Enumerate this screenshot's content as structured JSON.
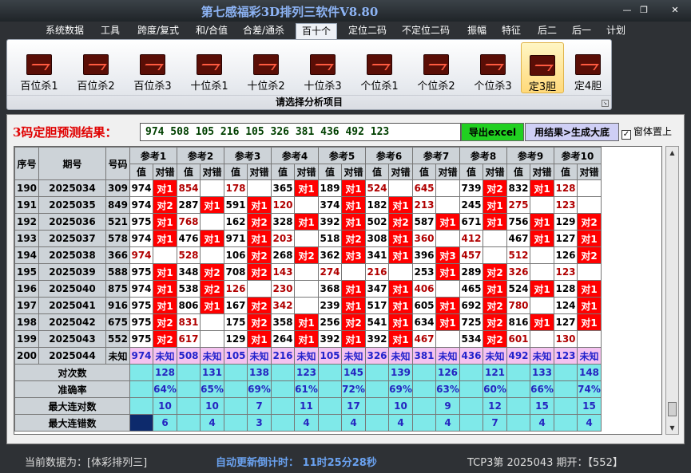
{
  "window": {
    "title": "第七感福彩3D排列三软件V8.80",
    "min": "—",
    "restore": "❐",
    "close": "✕"
  },
  "menu": [
    "系统数据",
    "工具",
    "跨度/复式",
    "和/合值",
    "合差/通杀",
    "百十个",
    "定位二码",
    "不定位二码",
    "振幅",
    "特征",
    "后二",
    "后一",
    "计划"
  ],
  "menu_selected": 5,
  "ribbon": {
    "buttons": [
      "百位杀1",
      "百位杀2",
      "百位杀3",
      "十位杀1",
      "十位杀2",
      "十位杀3",
      "个位杀1",
      "个位杀2",
      "个位杀3",
      "定3胆",
      "定4胆"
    ],
    "selected": 9,
    "caption": "请选择分析项目",
    "icon": "chart-icon"
  },
  "prediction": {
    "label": "3码定胆预测结果：",
    "value": "974 508 105 216 105 326 381 436 492 123",
    "export_btn": "导出excel",
    "gen_btn": "用结果>生成大底",
    "ontop_label": "窗体置上",
    "ontop_checked": "✓"
  },
  "table": {
    "col_seq": "序号",
    "col_period": "期号",
    "col_code": "号码",
    "refs": [
      "参考1",
      "参考2",
      "参考3",
      "参考4",
      "参考5",
      "参考6",
      "参考7",
      "参考8",
      "参考9",
      "参考10"
    ],
    "sub_val": "值",
    "sub_res": "对错",
    "hit": "对1",
    "miss": "对2",
    "rows": [
      {
        "seq": "190",
        "period": "2025034",
        "code": "309",
        "cells": [
          [
            "974",
            "对1"
          ],
          [
            "854",
            ""
          ],
          [
            "178",
            ""
          ],
          [
            "365",
            "对1"
          ],
          [
            "189",
            "对1"
          ],
          [
            "524",
            ""
          ],
          [
            "645",
            ""
          ],
          [
            "739",
            "对2"
          ],
          [
            "832",
            "对1"
          ],
          [
            "128",
            ""
          ]
        ]
      },
      {
        "seq": "191",
        "period": "2025035",
        "code": "849",
        "cells": [
          [
            "974",
            "对2"
          ],
          [
            "287",
            "对1"
          ],
          [
            "591",
            "对1"
          ],
          [
            "120",
            ""
          ],
          [
            "374",
            "对1"
          ],
          [
            "182",
            "对1"
          ],
          [
            "213",
            ""
          ],
          [
            "245",
            "对1"
          ],
          [
            "275",
            ""
          ],
          [
            "123",
            ""
          ]
        ]
      },
      {
        "seq": "192",
        "period": "2025036",
        "code": "521",
        "cells": [
          [
            "975",
            "对1"
          ],
          [
            "768",
            ""
          ],
          [
            "162",
            "对2"
          ],
          [
            "328",
            "对1"
          ],
          [
            "392",
            "对1"
          ],
          [
            "502",
            "对2"
          ],
          [
            "587",
            "对1"
          ],
          [
            "671",
            "对1"
          ],
          [
            "756",
            "对1"
          ],
          [
            "129",
            "对2"
          ]
        ]
      },
      {
        "seq": "193",
        "period": "2025037",
        "code": "578",
        "cells": [
          [
            "974",
            "对1"
          ],
          [
            "476",
            "对1"
          ],
          [
            "971",
            "对1"
          ],
          [
            "203",
            ""
          ],
          [
            "518",
            "对2"
          ],
          [
            "308",
            "对1"
          ],
          [
            "360",
            ""
          ],
          [
            "412",
            ""
          ],
          [
            "467",
            "对1"
          ],
          [
            "127",
            "对1"
          ]
        ]
      },
      {
        "seq": "194",
        "period": "2025038",
        "code": "366",
        "cells": [
          [
            "974",
            ""
          ],
          [
            "528",
            ""
          ],
          [
            "106",
            "对2"
          ],
          [
            "268",
            "对2"
          ],
          [
            "362",
            "对3"
          ],
          [
            "341",
            "对1"
          ],
          [
            "396",
            "对3"
          ],
          [
            "457",
            ""
          ],
          [
            "512",
            ""
          ],
          [
            "126",
            "对2"
          ]
        ]
      },
      {
        "seq": "195",
        "period": "2025039",
        "code": "588",
        "cells": [
          [
            "975",
            "对1"
          ],
          [
            "348",
            "对2"
          ],
          [
            "708",
            "对2"
          ],
          [
            "143",
            ""
          ],
          [
            "274",
            ""
          ],
          [
            "216",
            ""
          ],
          [
            "253",
            "对1"
          ],
          [
            "289",
            "对2"
          ],
          [
            "326",
            ""
          ],
          [
            "123",
            ""
          ]
        ]
      },
      {
        "seq": "196",
        "period": "2025040",
        "code": "875",
        "cells": [
          [
            "974",
            "对1"
          ],
          [
            "538",
            "对2"
          ],
          [
            "126",
            ""
          ],
          [
            "230",
            ""
          ],
          [
            "368",
            "对1"
          ],
          [
            "347",
            "对1"
          ],
          [
            "406",
            ""
          ],
          [
            "465",
            "对1"
          ],
          [
            "524",
            "对1"
          ],
          [
            "128",
            "对1"
          ]
        ]
      },
      {
        "seq": "197",
        "period": "2025041",
        "code": "916",
        "cells": [
          [
            "975",
            "对1"
          ],
          [
            "806",
            "对1"
          ],
          [
            "167",
            "对2"
          ],
          [
            "342",
            ""
          ],
          [
            "239",
            "对1"
          ],
          [
            "517",
            "对1"
          ],
          [
            "605",
            "对1"
          ],
          [
            "692",
            "对2"
          ],
          [
            "780",
            ""
          ],
          [
            "124",
            "对1"
          ]
        ]
      },
      {
        "seq": "198",
        "period": "2025042",
        "code": "675",
        "cells": [
          [
            "975",
            "对2"
          ],
          [
            "831",
            ""
          ],
          [
            "175",
            "对2"
          ],
          [
            "358",
            "对1"
          ],
          [
            "256",
            "对2"
          ],
          [
            "541",
            "对1"
          ],
          [
            "634",
            "对1"
          ],
          [
            "725",
            "对2"
          ],
          [
            "816",
            "对1"
          ],
          [
            "127",
            "对1"
          ]
        ]
      },
      {
        "seq": "199",
        "period": "2025043",
        "code": "552",
        "cells": [
          [
            "975",
            "对2"
          ],
          [
            "617",
            ""
          ],
          [
            "129",
            "对1"
          ],
          [
            "264",
            "对1"
          ],
          [
            "392",
            "对1"
          ],
          [
            "392",
            "对1"
          ],
          [
            "467",
            ""
          ],
          [
            "534",
            "对2"
          ],
          [
            "601",
            ""
          ],
          [
            "130",
            ""
          ]
        ]
      }
    ],
    "pred_row": {
      "seq": "200",
      "period": "2025044",
      "code": "未知",
      "vals": [
        "974",
        "508",
        "105",
        "216",
        "105",
        "326",
        "381",
        "436",
        "492",
        "123"
      ],
      "unknown": "未知"
    },
    "stats": [
      {
        "label": "对次数",
        "vals": [
          "128",
          "131",
          "138",
          "123",
          "145",
          "139",
          "126",
          "121",
          "133",
          "148"
        ]
      },
      {
        "label": "准确率",
        "vals": [
          "64%",
          "65%",
          "69%",
          "61%",
          "72%",
          "69%",
          "63%",
          "60%",
          "66%",
          "74%"
        ]
      },
      {
        "label": "最大连对数",
        "vals": [
          "10",
          "10",
          "7",
          "11",
          "17",
          "10",
          "9",
          "12",
          "15",
          "15"
        ]
      },
      {
        "label": "最大连错数",
        "vals": [
          "6",
          "4",
          "3",
          "4",
          "4",
          "4",
          "4",
          "7",
          "4",
          "4"
        ]
      }
    ]
  },
  "status": {
    "current": "当前数据为：[体彩排列三]",
    "update": "自动更新倒计时： 11时25分28秒",
    "tcp": "TCP3第 2025043 期开：【552】"
  }
}
